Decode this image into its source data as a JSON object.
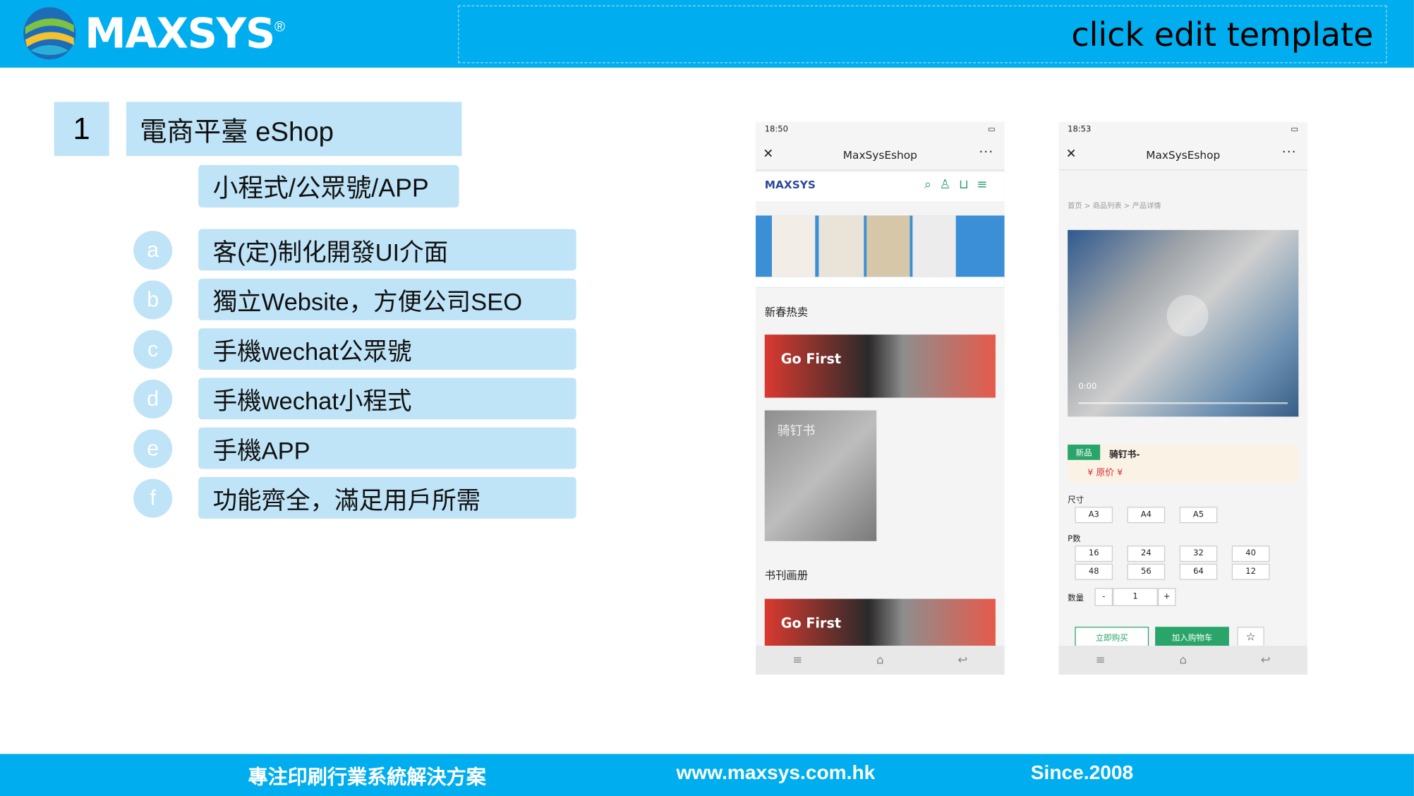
{
  "header": {
    "logo_text": "MAXSYS",
    "logo_mark": "®",
    "title": "click edit template"
  },
  "section": {
    "number": "1",
    "title": "電商平臺 eShop",
    "subtitle": "小程式/公眾號/APP"
  },
  "features": [
    {
      "letter": "a",
      "label": "客(定)制化開發UI介面"
    },
    {
      "letter": "b",
      "label": "獨立Website，方便公司SEO"
    },
    {
      "letter": "c",
      "label": "手機wechat公眾號"
    },
    {
      "letter": "d",
      "label": "手機wechat小程式"
    },
    {
      "letter": "e",
      "label": "手機APP"
    },
    {
      "letter": "f",
      "label": "功能齊全，滿足用戶所需"
    }
  ],
  "phone1": {
    "status_time": "18:50",
    "title": "MaxSysEshop",
    "close": "✕",
    "more": "···",
    "nav_logo": "MAXSYS",
    "section1": "新春热卖",
    "section2": "书刊画册",
    "promo_text": "Go First",
    "book_text": "骑钉书"
  },
  "phone2": {
    "status_time": "18:53",
    "title": "MaxSysEshop",
    "close": "✕",
    "more": "···",
    "breadcrumb": "首页 > 商品列表 > 产品详情",
    "video_time": "0:00",
    "tag_new": "新品",
    "product_name": "骑钉书-",
    "price": "¥  原价 ¥",
    "size_label": "尺寸",
    "sizes": [
      "A3",
      "A4",
      "A5"
    ],
    "pages_label": "P数",
    "pages": [
      "16",
      "24",
      "32",
      "40",
      "48",
      "56",
      "64",
      "12"
    ],
    "qty_label": "数量",
    "qty_minus": "-",
    "qty_value": "1",
    "qty_plus": "+",
    "buy_now": "立即购买",
    "add_cart": "加入购物车",
    "fav": "☆"
  },
  "footer": {
    "slogan": "專注印刷行業系統解決方案",
    "website": "www.maxsys.com.hk",
    "since": "Since.2008"
  },
  "colors": {
    "brand_blue": "#00aeef",
    "light_blue": "#bfe3f7",
    "green": "#2aa56a"
  }
}
